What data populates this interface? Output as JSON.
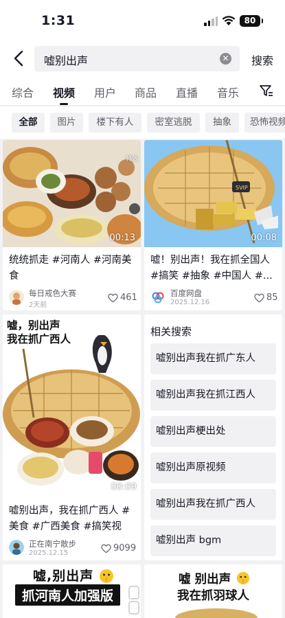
{
  "status_bar": {
    "time": "1:31",
    "battery": "80"
  },
  "search": {
    "query": "嘘别出声",
    "submit_label": "搜索"
  },
  "tabs": [
    {
      "label": "综合"
    },
    {
      "label": "视频"
    },
    {
      "label": "用户"
    },
    {
      "label": "商品"
    },
    {
      "label": "直播"
    },
    {
      "label": "音乐"
    }
  ],
  "chips": [
    {
      "label": "全部"
    },
    {
      "label": "图片"
    },
    {
      "label": "楼下有人"
    },
    {
      "label": "密室逃脱"
    },
    {
      "label": "抽象"
    },
    {
      "label": "恐怖视频"
    }
  ],
  "cards": [
    {
      "duration": "00:13",
      "badge": "特效",
      "title": "统统抓走 #河南人 #河南美食",
      "author": "每日戒色大赛",
      "date": "2天前",
      "likes": "461"
    },
    {
      "duration": "00:08",
      "title": "嘘！别出声！我在抓全国人 #搞笑 #抽象 #中国人 #...",
      "author": "百度网盘",
      "date": "2025.12.16",
      "likes": "85"
    },
    {
      "duration": "00:09",
      "overlay_line1": "嘘，别出声",
      "overlay_line2": "我在抓广西人",
      "title": "嘘别出声，我在抓广西人 #美食 #广西美食 #搞笑视频...",
      "author": "正在南宁散步",
      "date": "2025.12.15",
      "likes": "9099"
    },
    {
      "overlay_line1": "嘘,别出声",
      "overlay_line2": "抓河南人加强版"
    },
    {
      "overlay_line1": "嘘  别出声",
      "overlay_line2": "我在抓羽球人"
    }
  ],
  "related": {
    "title": "相关搜索",
    "items": [
      {
        "label": "嘘别出声我在抓广东人"
      },
      {
        "label": "嘘别出声我在抓江西人"
      },
      {
        "label": "嘘别出声梗出处"
      },
      {
        "label": "嘘别出声原视频"
      },
      {
        "label": "嘘别出声我在抓广西人"
      },
      {
        "label": "嘘别出声 bgm"
      }
    ]
  },
  "colors": {
    "accent": "#161823",
    "secondary_text": "#5f6068",
    "page_bg": "#f2f2f4",
    "chip_bg": "#f1f1f3"
  },
  "icons": [
    "back-icon",
    "clear-icon",
    "filter-icon",
    "heart-icon",
    "signal-icon",
    "wifi-icon",
    "battery-icon"
  ]
}
